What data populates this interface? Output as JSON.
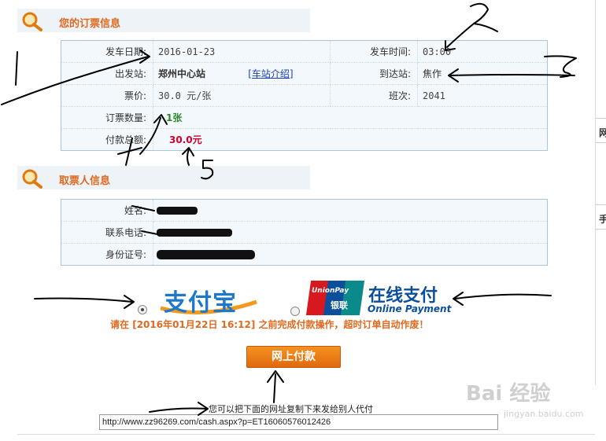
{
  "order_section": {
    "title": "您的订票信息",
    "departure_date_label": "发车日期:",
    "departure_date": "2016-01-23",
    "departure_time_label": "发车时间:",
    "departure_time": "03:00",
    "from_station_label": "出发站:",
    "from_station": "郑州中心站",
    "station_intro_link": "[车站介绍]",
    "to_station_label": "到达站:",
    "to_station": "焦作",
    "price_label": "票价:",
    "price": "30.0 元/张",
    "train_no_label": "班次:",
    "train_no": "2041",
    "quantity_label": "订票数量:",
    "quantity": "1张",
    "total_label": "付款总额:",
    "total": "30.0元"
  },
  "passenger_section": {
    "title": "取票人信息",
    "name_label": "姓名:",
    "phone_label": "联系电话:",
    "id_label": "身份证号:"
  },
  "payment": {
    "alipay_brand": "支付宝",
    "unionpay_brand_top": "UnionPay",
    "unionpay_brand_cn": "银联",
    "unionpay_title": "在线支付",
    "unionpay_subtitle": "Online Payment",
    "notice_prefix": "请在",
    "notice_deadline": "[2016年01月22日 16:12]",
    "notice_suffix": "之前完成付款操作，超时订单自动作废！",
    "pay_button": "网上付款",
    "share_hint": "您可以把下面的网址复制下来发给别人代付",
    "share_url": "http://www.zz96269.com/cash.aspx?p=ET16060576012426",
    "alipay_selected": true
  },
  "side_panel": {
    "char1": "网",
    "char2": "手"
  },
  "annotations": {
    "n1": "1",
    "n2": "2",
    "n3": "3",
    "n4": "4",
    "n5": "5"
  },
  "watermark": {
    "brand": "Bai 经验",
    "url": "jingyan.baidu.com"
  },
  "colors": {
    "accent_orange": "#e0691f",
    "green": "#2a8a2a",
    "red": "#d0002a",
    "border": "#a9c4dd"
  }
}
